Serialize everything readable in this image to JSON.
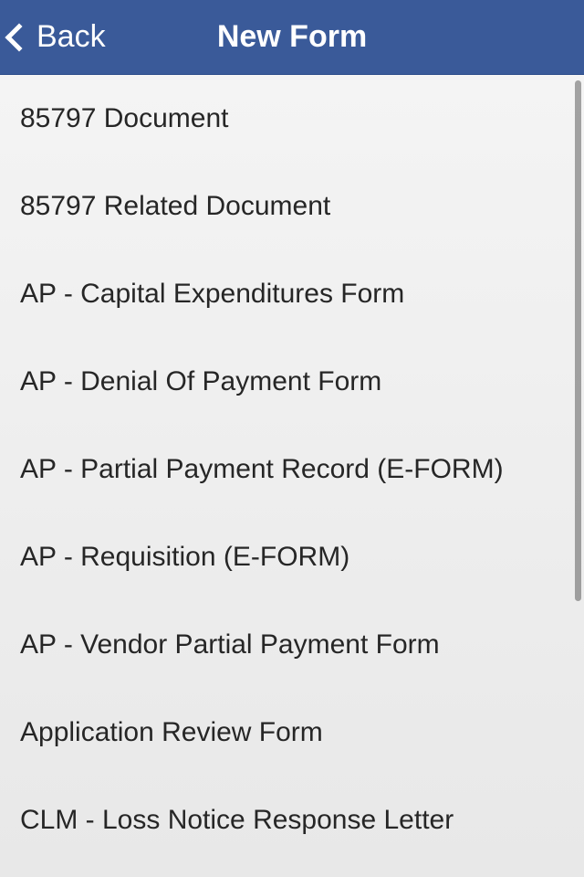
{
  "nav": {
    "back_label": "Back",
    "title": "New Form"
  },
  "list": {
    "items": [
      {
        "label": "85797 Document"
      },
      {
        "label": "85797 Related Document"
      },
      {
        "label": "AP - Capital Expenditures Form"
      },
      {
        "label": "AP - Denial Of Payment Form"
      },
      {
        "label": "AP - Partial Payment Record (E-FORM)"
      },
      {
        "label": "AP - Requisition (E-FORM)"
      },
      {
        "label": "AP - Vendor Partial Payment Form"
      },
      {
        "label": "Application Review Form"
      },
      {
        "label": "CLM - Loss Notice Response Letter"
      }
    ]
  }
}
